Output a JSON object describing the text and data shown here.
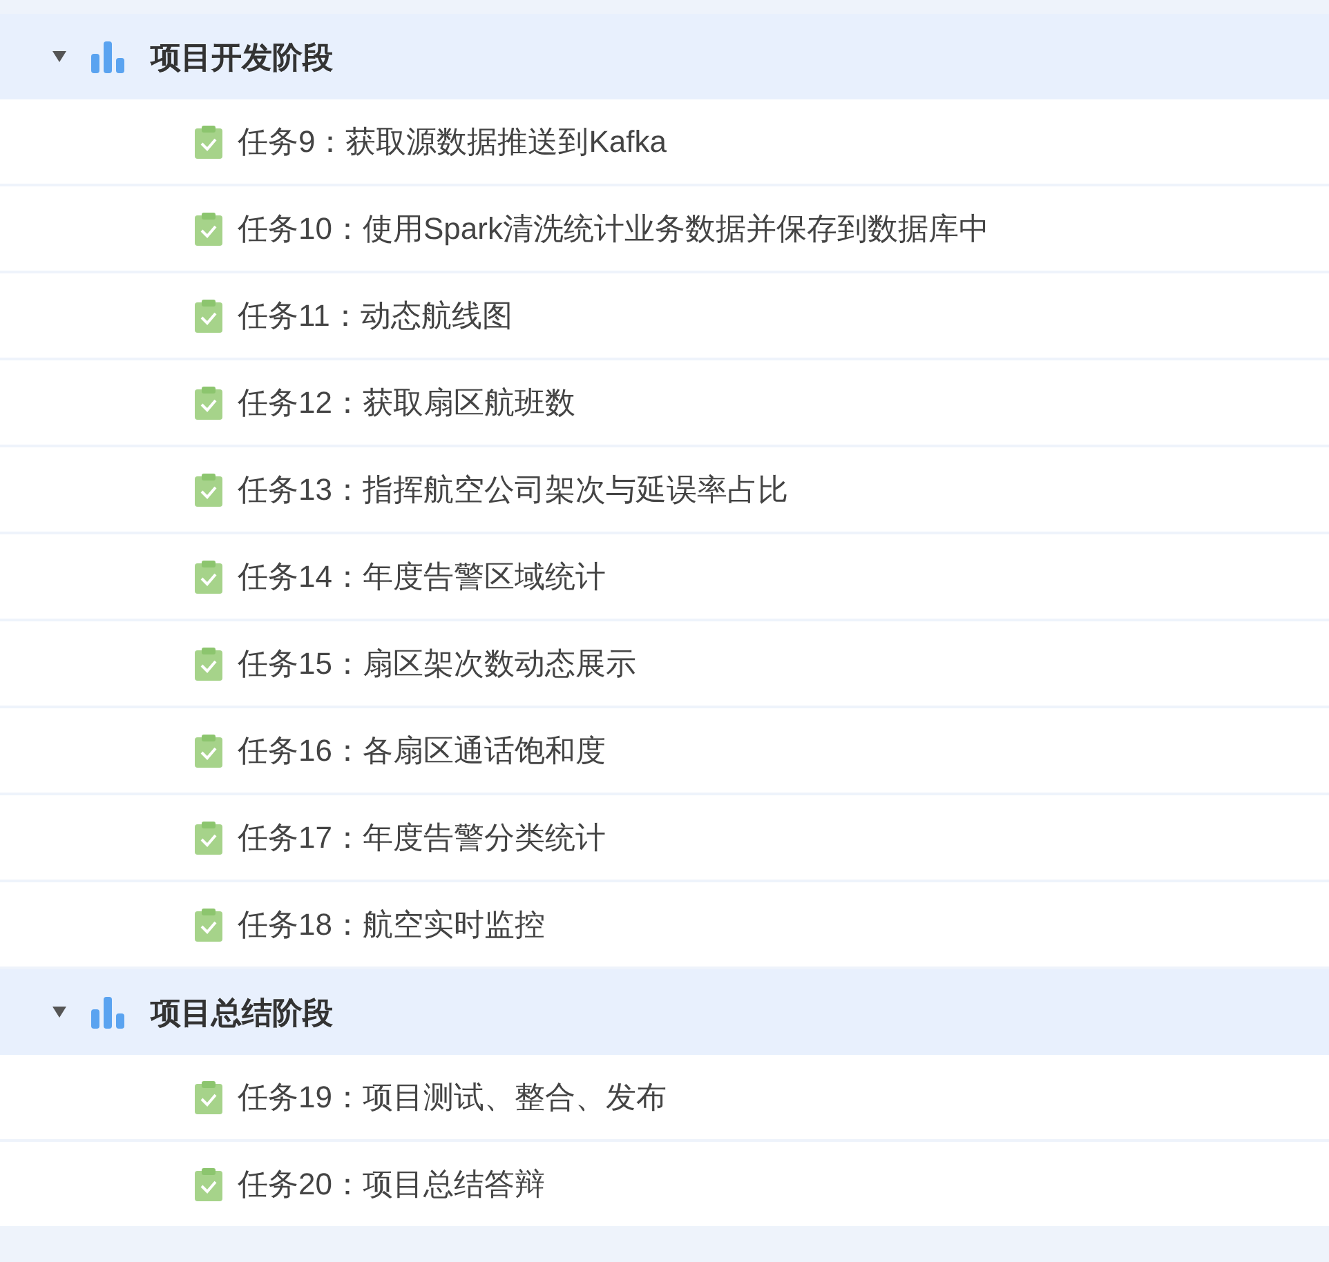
{
  "tree": [
    {
      "label": "项目开发阶段",
      "expanded": true,
      "children": [
        {
          "label": "任务9：获取源数据推送到Kafka"
        },
        {
          "label": "任务10：使用Spark清洗统计业务数据并保存到数据库中"
        },
        {
          "label": "任务11：动态航线图"
        },
        {
          "label": "任务12：获取扇区航班数"
        },
        {
          "label": "任务13：指挥航空公司架次与延误率占比"
        },
        {
          "label": "任务14：年度告警区域统计"
        },
        {
          "label": "任务15：扇区架次数动态展示"
        },
        {
          "label": "任务16：各扇区通话饱和度"
        },
        {
          "label": "任务17：年度告警分类统计"
        },
        {
          "label": "任务18：航空实时监控"
        }
      ]
    },
    {
      "label": "项目总结阶段",
      "expanded": true,
      "children": [
        {
          "label": "任务19：项目测试、整合、发布"
        },
        {
          "label": "任务20：项目总结答辩"
        }
      ]
    }
  ]
}
